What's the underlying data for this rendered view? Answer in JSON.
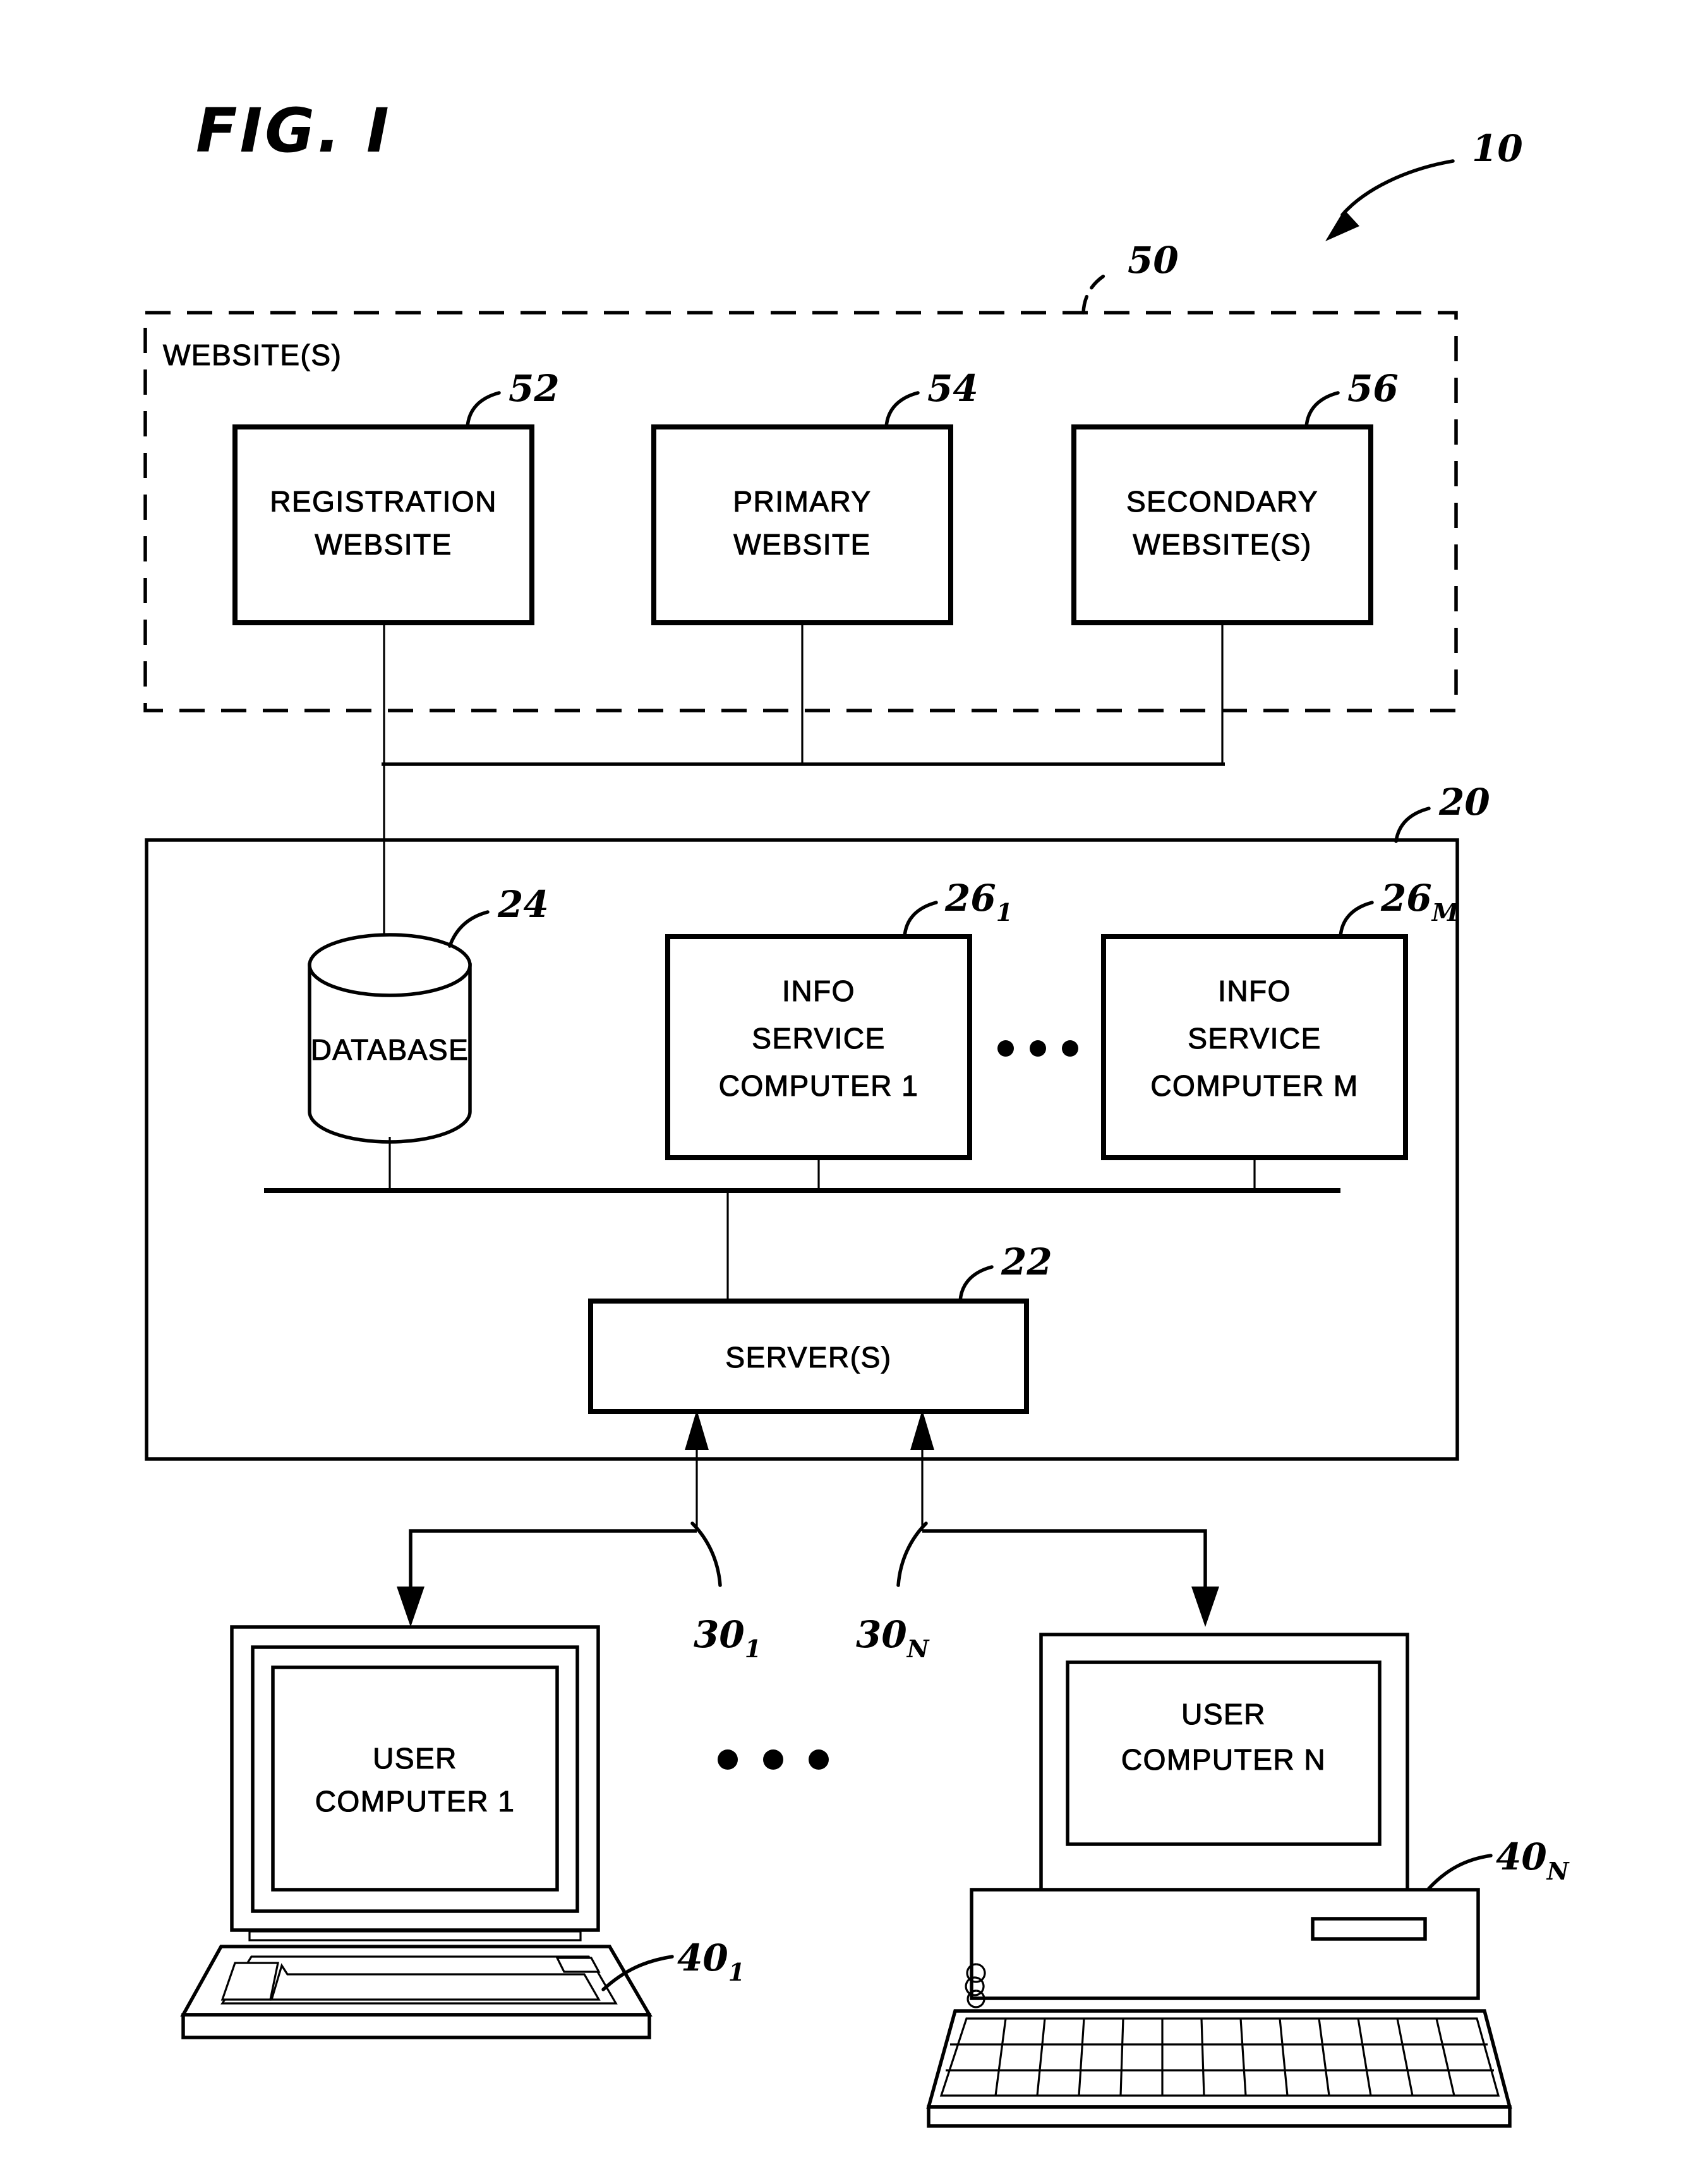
{
  "figure": {
    "title": "FIG. I",
    "system_ref": "10"
  },
  "website_group": {
    "label": "WEBSITE(S)",
    "ref": "50",
    "boxes": [
      {
        "line1": "REGISTRATION",
        "line2": "WEBSITE",
        "ref": "52"
      },
      {
        "line1": "PRIMARY",
        "line2": "WEBSITE",
        "ref": "54"
      },
      {
        "line1": "SECONDARY",
        "line2": "WEBSITE(S)",
        "ref": "56"
      }
    ]
  },
  "system": {
    "ref": "20",
    "database": {
      "label": "DATABASE",
      "ref": "24"
    },
    "info_service_computers": [
      {
        "line1": "INFO",
        "line2": "SERVICE",
        "line3": "COMPUTER 1",
        "ref_base": "26",
        "ref_sub": "1"
      },
      {
        "line1": "INFO",
        "line2": "SERVICE",
        "line3": "COMPUTER M",
        "ref_base": "26",
        "ref_sub": "M"
      }
    ],
    "info_service_ellipsis": "• • •",
    "server": {
      "label": "SERVER(S)",
      "ref": "22"
    }
  },
  "links": [
    {
      "ref_base": "30",
      "ref_sub": "1"
    },
    {
      "ref_base": "30",
      "ref_sub": "N"
    }
  ],
  "user_computers": [
    {
      "line1": "USER",
      "line2": "COMPUTER 1",
      "ref_base": "40",
      "ref_sub": "1",
      "type": "laptop"
    },
    {
      "line1": "USER",
      "line2": "COMPUTER N",
      "ref_base": "40",
      "ref_sub": "N",
      "type": "desktop"
    }
  ],
  "user_ellipsis": "• • •",
  "colors": {
    "ink": "#000000",
    "paper": "#ffffff"
  }
}
